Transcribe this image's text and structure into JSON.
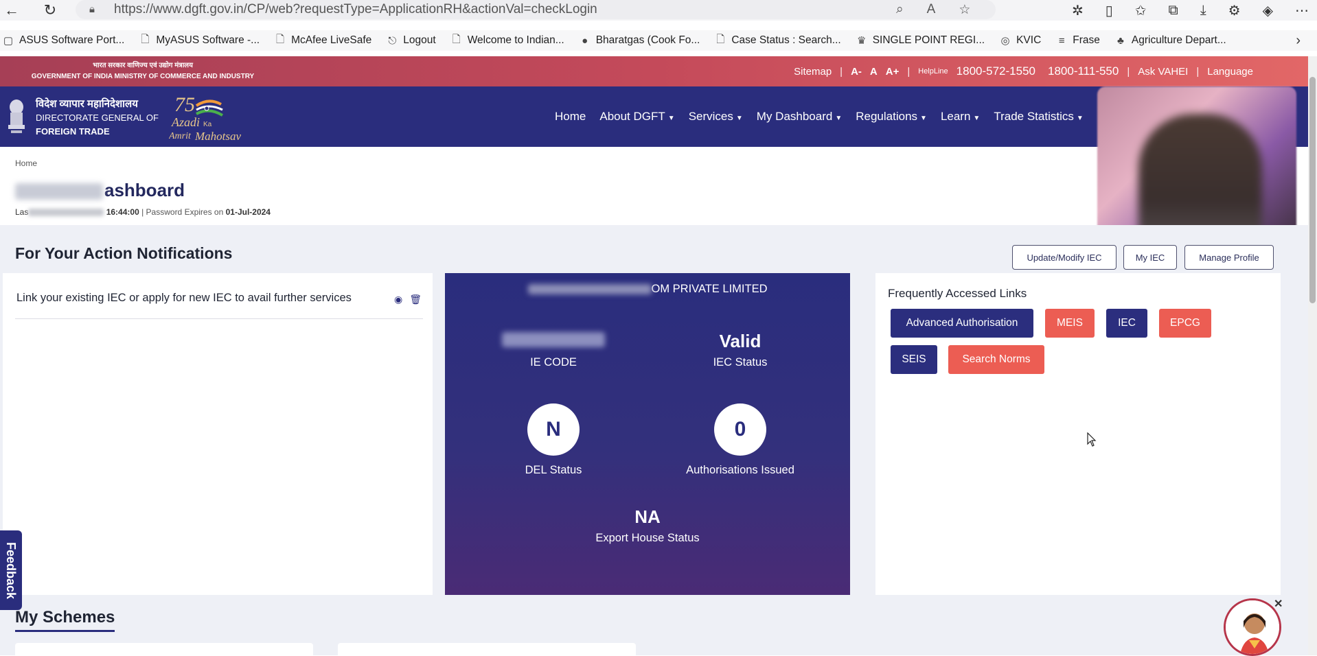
{
  "browser": {
    "url": "https://www.dgft.gov.in/CP/web?requestType=ApplicationRH&actionVal=checkLogin",
    "bookmarks": [
      {
        "label": "ASUS Software Port...",
        "icon": "asus-icon"
      },
      {
        "label": "MyASUS Software -...",
        "icon": "page-icon"
      },
      {
        "label": "McAfee LiveSafe",
        "icon": "page-icon"
      },
      {
        "label": "Logout",
        "icon": "logout-icon"
      },
      {
        "label": "Welcome to Indian...",
        "icon": "page-icon"
      },
      {
        "label": "Bharatgas (Cook Fo...",
        "icon": "bharatgas-icon"
      },
      {
        "label": "Case Status : Search...",
        "icon": "page-icon"
      },
      {
        "label": "SINGLE POINT REGI...",
        "icon": "emblem-icon"
      },
      {
        "label": "KVIC",
        "icon": "kvic-icon"
      },
      {
        "label": "Frase",
        "icon": "frase-icon"
      },
      {
        "label": "Agriculture Depart...",
        "icon": "agri-icon"
      }
    ]
  },
  "gov_strip": {
    "hindi_left": "भारत सरकार   वाणिज्य एवं उद्योग मंत्रालय",
    "english_left": "GOVERNMENT OF INDIA   MINISTRY OF COMMERCE AND INDUSTRY",
    "sitemap": "Sitemap",
    "font_minus": "A-",
    "font_normal": "A",
    "font_plus": "A+",
    "helpline_label": "HelpLine",
    "helpline_1": "1800-572-1550",
    "helpline_2": "1800-111-550",
    "ask": "Ask VAHEI",
    "language": "Language"
  },
  "brand": {
    "hindi": "विदेश व्यापार महानिदेशालय",
    "line1": "DIRECTORATE GENERAL OF",
    "line2": "FOREIGN TRADE",
    "azadi_75": "75",
    "azadi_text": "Azadi",
    "azadi_ka": "Ka",
    "azadi_amrit": "Amrit",
    "azadi_mahotsav": "Mahotsav"
  },
  "nav": [
    {
      "label": "Home",
      "dropdown": false
    },
    {
      "label": "About DGFT",
      "dropdown": true
    },
    {
      "label": "Services",
      "dropdown": true
    },
    {
      "label": "My Dashboard",
      "dropdown": true
    },
    {
      "label": "Regulations",
      "dropdown": true
    },
    {
      "label": "Learn",
      "dropdown": true
    },
    {
      "label": "Trade Statistics",
      "dropdown": true
    }
  ],
  "page": {
    "breadcrumb": "Home",
    "title_suffix": "ashboard",
    "last_login_prefix": "Las",
    "last_login_time": "16:44:00",
    "password_expires_label": "| Password Expires on",
    "password_expires_date": "01-Jul-2024",
    "section_title": "For Your Action Notifications",
    "buttons": {
      "update_iec": "Update/Modify IEC",
      "my_iec": "My IEC",
      "manage_profile": "Manage Profile"
    }
  },
  "notifications": [
    {
      "text": "Link your existing IEC or apply for new IEC to avail further services"
    }
  ],
  "iec_card": {
    "company_suffix": "OM PRIVATE LIMITED",
    "iec_code_label": "IE CODE",
    "iec_status_value": "Valid",
    "iec_status_label": "IEC Status",
    "del_status_value": "N",
    "del_status_label": "DEL Status",
    "authorisations_value": "0",
    "authorisations_label": "Authorisations Issued",
    "export_house_value": "NA",
    "export_house_label": "Export House Status"
  },
  "frequent_links": {
    "title": "Frequently Accessed Links",
    "items": [
      {
        "label": "Advanced Authorisation",
        "style": "navy"
      },
      {
        "label": "MEIS",
        "style": "red"
      },
      {
        "label": "IEC",
        "style": "navy"
      },
      {
        "label": "EPCG",
        "style": "red"
      },
      {
        "label": "SEIS",
        "style": "navy"
      },
      {
        "label": "Search Norms",
        "style": "red"
      }
    ]
  },
  "feedback": "Feedback",
  "my_schemes": "My Schemes",
  "colors": {
    "navy": "#2a2d7d",
    "red_chip": "#ec5d53",
    "strip_red": "#c44a5a"
  }
}
